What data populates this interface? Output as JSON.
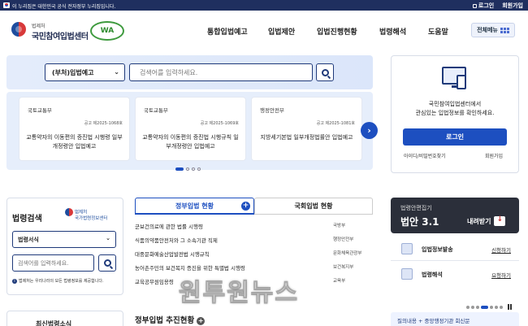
{
  "topbar": {
    "notice": "이 누리집은 대한민국 공식 전자정부 누리집입니다.",
    "login": "로그인",
    "join": "회원가입"
  },
  "header": {
    "org_small": "법제처",
    "org_name": "국민참여입법센터",
    "badge": "WA",
    "nav": [
      "통합입법예고",
      "입법제안",
      "입법진행현황",
      "법령해석",
      "도움말"
    ],
    "all_menu": "전체메뉴"
  },
  "search": {
    "category": "(부처)입법예고",
    "placeholder": "검색어를 입력하세요."
  },
  "cards": [
    {
      "dept": "국토교통부",
      "num": "공고 제2025-1068호",
      "title": "교통약자의 이동편의 증진법 시행령 일부개정령안 입법예고"
    },
    {
      "dept": "국토교통부",
      "num": "공고 제2025-1069호",
      "title": "교통약자의 이동편의 증진법 시행규칙 일부개정령안 입법예고"
    },
    {
      "dept": "행정안전부",
      "num": "공고 제2025-1081호",
      "title": "지방세기본법 일부개정법률안 입법예고"
    }
  ],
  "login": {
    "message_line1": "국민참여입법센터에서",
    "message_line2": "관심있는 입법정보를 확인하세요.",
    "button": "로그인",
    "find_id": "아이디/비밀번호찾기",
    "join": "회원가입"
  },
  "law_search": {
    "title": "법령검색",
    "logo_line1": "법제처",
    "logo_line2": "국가법령정보센터",
    "select": "법령서식",
    "placeholder": "검색어를 입력하세요.",
    "note": "법제처는 우리나라의 모든 법령정보를 제공합니다."
  },
  "tabs": {
    "gov": "정부입법 현황",
    "assembly": "국회입법 현황"
  },
  "gov_list": [
    {
      "title": "군보건의료에 관한 법률 시행령",
      "dept": "국방부"
    },
    {
      "title": "식품의약품안전처와 그 소속기관 직제",
      "dept": "행정안전부"
    },
    {
      "title": "대중문화예술산업발전법 시행규칙",
      "dept": "문화체육관광부"
    },
    {
      "title": "농어촌주민의 보건복지 증진을 위한 특별법 시행령",
      "dept": "보건복지부"
    },
    {
      "title": "교육공무원임용령",
      "dept": "교육부"
    }
  ],
  "progress_title": "정부입법 추진현황",
  "recent_title": "최신법령소식",
  "guide": {
    "label": "법령안편집기",
    "version": "법안 3.1",
    "download": "내려받기"
  },
  "services": [
    {
      "name": "입법정보발송",
      "action": "신청하기"
    },
    {
      "name": "법령해석",
      "action": "요청하기"
    }
  ],
  "faq": "질의내용 + 중앙행정기관 회신문",
  "watermark": "원투원뉴스"
}
